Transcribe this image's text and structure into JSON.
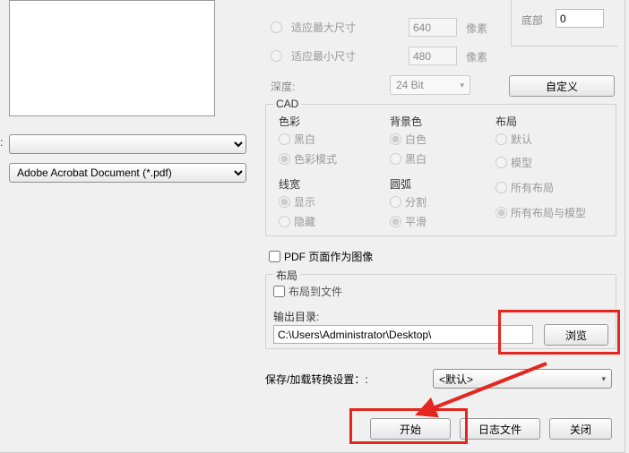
{
  "left": {
    "colon_label": ":",
    "combo1": "",
    "combo2": "Adobe Acrobat Document (*.pdf)"
  },
  "sizeOptions": {
    "maxFit": "适应最大尺寸",
    "minFit": "适应最小尺寸",
    "depth": "深度:",
    "depth_value": "24 Bit",
    "width_val": "640",
    "height_val": "480",
    "unit": "像素",
    "bottom_label": "底部",
    "bottom_val": "0",
    "customize": "自定义"
  },
  "cad": {
    "title": "CAD",
    "color": {
      "label": "色彩",
      "bw": "黑白",
      "colormode": "色彩模式"
    },
    "bg": {
      "label": "背景色",
      "white": "白色",
      "black": "黑白"
    },
    "layout": {
      "label": "布局",
      "default_": "默认",
      "model": "模型",
      "allLayouts": "所有布局",
      "allLayoutsModel": "所有布局与模型"
    },
    "linew": {
      "label": "线宽",
      "show": "显示",
      "hide": "隐藏"
    },
    "arc": {
      "label": "圆弧",
      "split": "分割",
      "smooth": "平滑"
    }
  },
  "pdfPageAsImage": "PDF 页面作为图像",
  "layoutGroup": {
    "title": "布局",
    "toFile": "布局到文件",
    "outputDir": "输出目录:",
    "path": "C:\\Users\\Administrator\\Desktop\\",
    "browse": "浏览"
  },
  "settings": {
    "label": "保存/加载转换设置：:",
    "value": "<默认>"
  },
  "buttons": {
    "start": "开始",
    "logfile": "日志文件",
    "close": "关闭"
  }
}
